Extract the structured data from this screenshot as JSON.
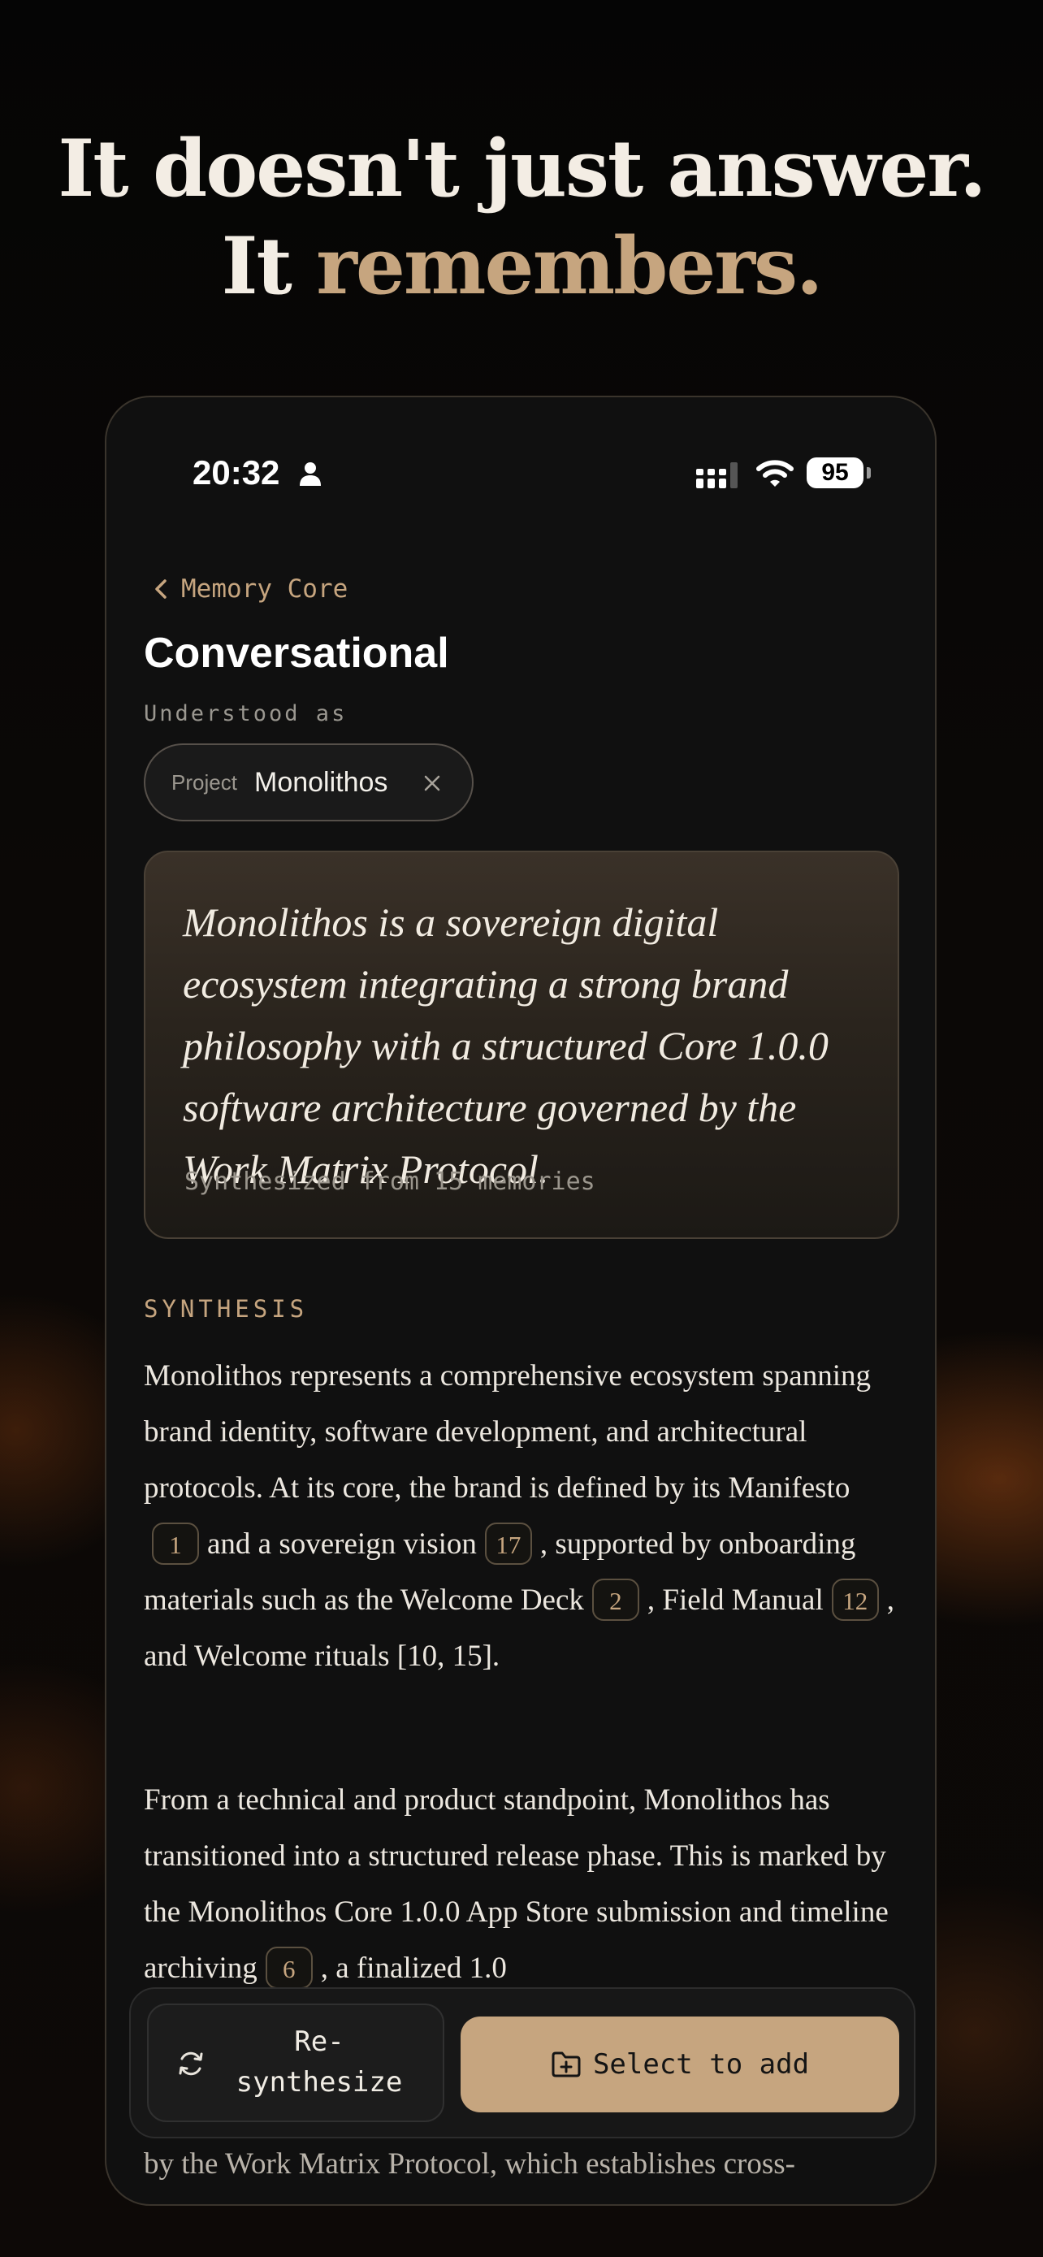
{
  "headline": {
    "line1": "It doesn't just answer.",
    "line2_prefix": "It ",
    "line2_accent": "remembers."
  },
  "status_bar": {
    "time": "20:32",
    "battery": "95"
  },
  "nav": {
    "back_label": "Memory Core"
  },
  "page": {
    "title": "Conversational",
    "understood_as": "Understood as"
  },
  "chip": {
    "label": "Project",
    "value": "Monolithos"
  },
  "summary_card": {
    "quote": "Monolithos is a sovereign digital ecosystem integrating a strong brand philosophy with a structured Core 1.0.0 software architecture governed by the Work Matrix Protocol.",
    "meta": "Synthesized from 15 memories"
  },
  "synthesis": {
    "label": "SYNTHESIS",
    "p1": {
      "a": "Monolithos represents a comprehensive ecosystem spanning brand identity, software development, and architectural protocols. At its core, the brand is defined by its Manifesto",
      "c1": "1",
      "b": "and a sovereign vision",
      "c2": "17",
      "c": ", supported by onboarding materials such as the Welcome Deck",
      "c3": "2",
      "d": ", Field Manual",
      "c4": "12",
      "e": ", and Welcome rituals [10, 15]."
    },
    "p2": {
      "a": "From a technical and product standpoint, Monolithos has transitioned into a structured release phase. This is marked by the Monolithos Core 1.0.0 App Store submission and timeline archiving",
      "c1": "6",
      "b": ", a finalized 1.0"
    },
    "p3": "by the Work Matrix Protocol, which establishes cross-"
  },
  "actions": {
    "resynthesize_label": "Re-\nsynthesize",
    "select_label": "Select to add"
  },
  "colors": {
    "accent": "#c6a57f",
    "background": "#101010"
  }
}
